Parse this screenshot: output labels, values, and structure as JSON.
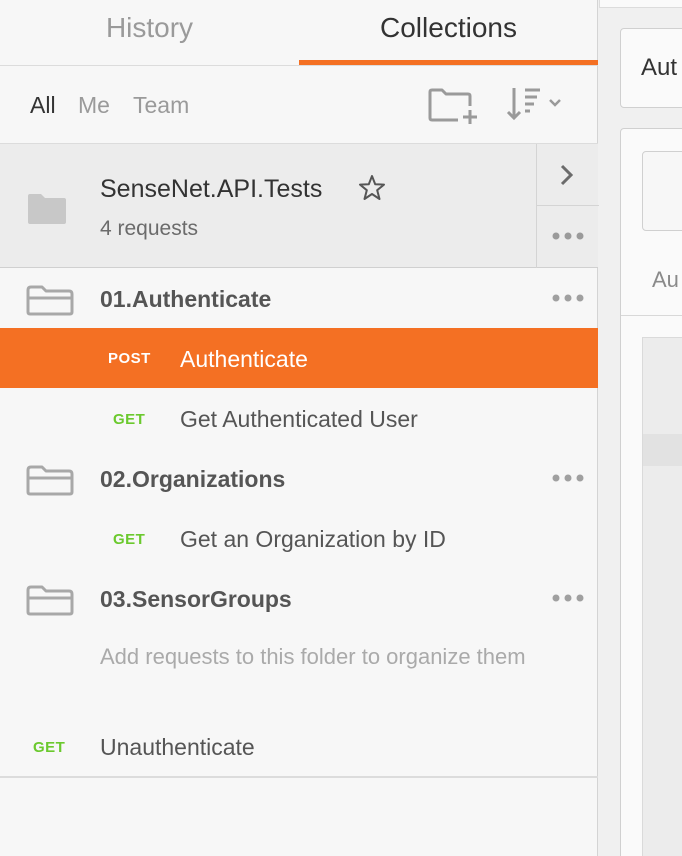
{
  "tabs": {
    "history": "History",
    "collections": "Collections"
  },
  "filters": {
    "all": "All",
    "me": "Me",
    "team": "Team"
  },
  "toolbar": {
    "new_folder_icon": "new-folder-icon",
    "sort_icon": "sort-icon"
  },
  "collection": {
    "name": "SenseNet.API.Tests",
    "request_count": "4 requests",
    "star_icon": "star-icon"
  },
  "folders": [
    {
      "name": "01.Authenticate",
      "requests": [
        {
          "method": "POST",
          "name": "Authenticate",
          "active": true
        },
        {
          "method": "GET",
          "name": "Get Authenticated User",
          "active": false
        }
      ]
    },
    {
      "name": "02.Organizations",
      "requests": [
        {
          "method": "GET",
          "name": "Get an Organization by ID",
          "active": false
        }
      ]
    },
    {
      "name": "03.SensorGroups",
      "empty_hint": "Add requests to this folder to organize them",
      "requests": []
    }
  ],
  "loose_requests": [
    {
      "method": "GET",
      "name": "Unauthenticate"
    }
  ],
  "main": {
    "tab_label": "Aut",
    "sub_label": "Au"
  },
  "colors": {
    "accent": "#f47023",
    "get": "#6bc92e",
    "post_on_accent": "#ffffff"
  }
}
